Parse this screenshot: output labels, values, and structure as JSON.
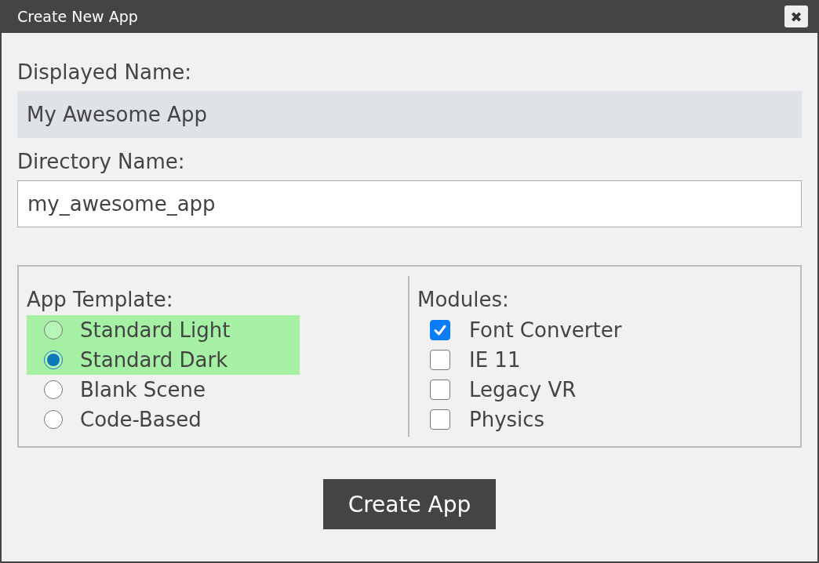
{
  "window": {
    "title": "Create New App",
    "close": "✖"
  },
  "displayed_name": {
    "label": "Displayed Name:",
    "value": "My Awesome App",
    "disabled": true
  },
  "directory_name": {
    "label": "Directory Name:",
    "value": "my_awesome_app",
    "disabled": false
  },
  "app_template": {
    "label": "App Template:",
    "options": [
      {
        "label": "Standard Light",
        "selected": false,
        "highlighted": true
      },
      {
        "label": "Standard Dark",
        "selected": true,
        "highlighted": true
      },
      {
        "label": "Blank Scene",
        "selected": false,
        "highlighted": false
      },
      {
        "label": "Code-Based",
        "selected": false,
        "highlighted": false
      }
    ]
  },
  "modules": {
    "label": "Modules:",
    "items": [
      {
        "label": "Font Converter",
        "checked": true
      },
      {
        "label": "IE 11",
        "checked": false
      },
      {
        "label": "Legacy VR",
        "checked": false
      },
      {
        "label": "Physics",
        "checked": false
      }
    ]
  },
  "button": "Create App"
}
